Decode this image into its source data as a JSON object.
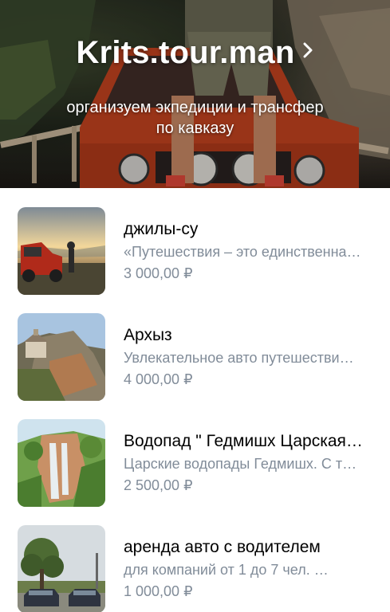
{
  "header": {
    "title": "Krits.tour.man",
    "subtitle": "организуем экпедиции и трансфер\nпо кавказу",
    "background_icon": "jeep-photo"
  },
  "products": [
    {
      "title": "джилы-су",
      "description": "«Путешествия – это единственна…",
      "price": "3 000,00 ₽",
      "image": "sunset-jeep-photo"
    },
    {
      "title": "Архыз",
      "description": "Увлекательное авто путешестви…",
      "price": "4 000,00 ₽",
      "image": "mountain-church-photo"
    },
    {
      "title": "Водопад \" Гедмишх Царская…",
      "description": "Царские водопады Гедмишх. С т…",
      "price": "2 500,00 ₽",
      "image": "waterfall-photo"
    },
    {
      "title": "аренда авто с водителем",
      "description": "для компаний от 1 до 7 чел. …",
      "price": "1 000,00 ₽",
      "image": "cars-tree-photo"
    }
  ],
  "colors": {
    "secondary_text": "#818c99",
    "primary_text": "#000000"
  }
}
